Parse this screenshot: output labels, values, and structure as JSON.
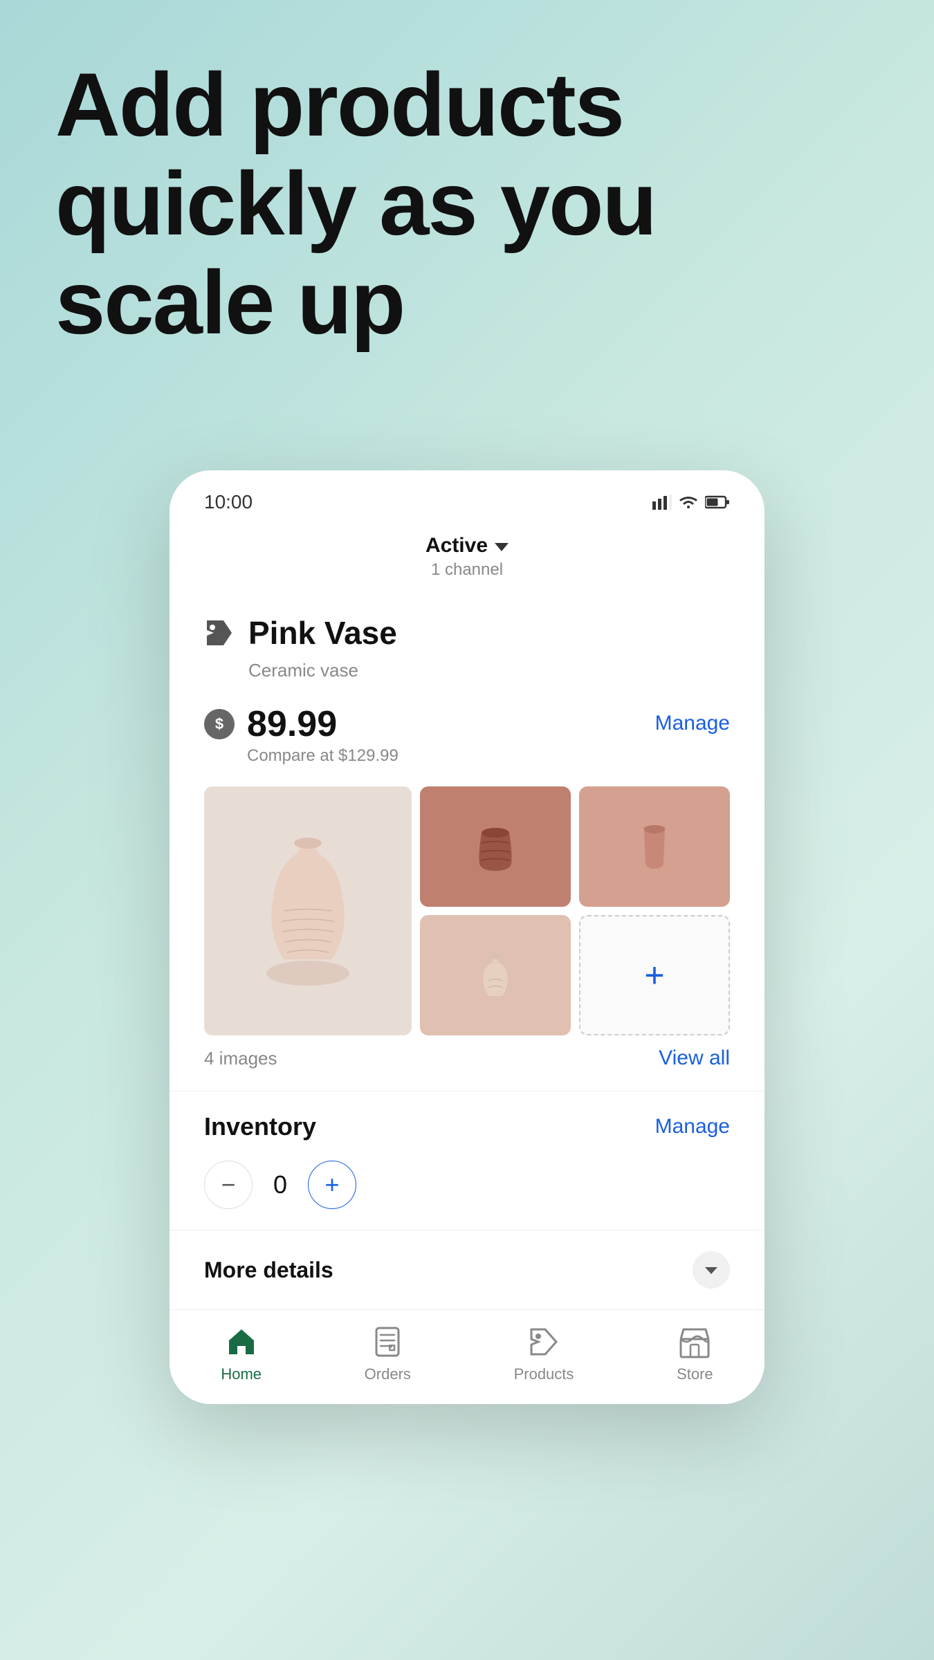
{
  "hero": {
    "title_line1": "Add products",
    "title_line2": "quickly as you",
    "title_line3": "scale up"
  },
  "status_bar": {
    "time": "10:00"
  },
  "header": {
    "status": "Active",
    "channel_count": "1 channel",
    "chevron": "▾"
  },
  "product": {
    "name": "Pink Vase",
    "subtitle": "Ceramic vase",
    "price": "89.99",
    "compare_price": "Compare at $129.99",
    "manage_label": "Manage",
    "images_count": "4 images",
    "view_all_label": "View all"
  },
  "inventory": {
    "title": "Inventory",
    "manage_label": "Manage",
    "quantity": "0",
    "minus_label": "−",
    "plus_label": "+"
  },
  "more_details": {
    "label": "More details"
  },
  "bottom_nav": {
    "items": [
      {
        "label": "Home",
        "active": true
      },
      {
        "label": "Orders",
        "active": false
      },
      {
        "label": "Products",
        "active": false
      },
      {
        "label": "Store",
        "active": false
      }
    ]
  }
}
